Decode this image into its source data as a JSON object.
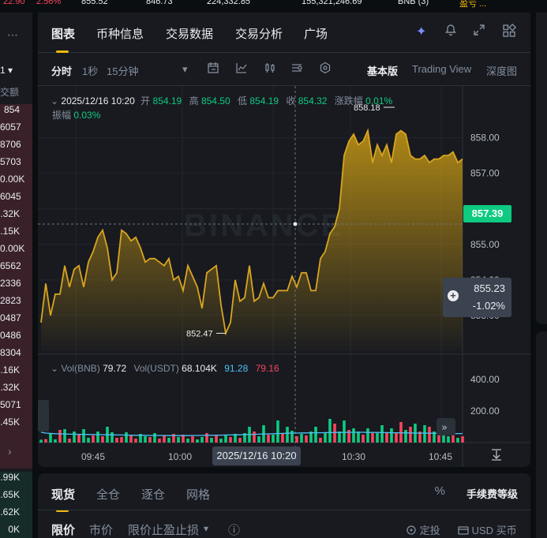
{
  "top_strip": {
    "a": "22.90",
    "b": "2.56%",
    "c": "855.52",
    "d": "846.73",
    "e": "224,332.85",
    "f": "155,321,246.69",
    "g": "BNB (3)",
    "h": "盈亏 ..."
  },
  "orderbook": {
    "selector": "1 ▾",
    "header": "交额",
    "rows": [
      "854",
      "6057",
      "8706",
      "5703",
      "0.00K",
      "6045",
      ".32K",
      ".15K",
      "0.00K",
      "6562",
      "2336",
      "2823",
      "0487",
      "0486",
      "8304",
      ".16K",
      ".32K",
      "5071",
      ".45K",
      "",
      "",
      ".99K",
      ".65K",
      ".62K",
      "0K"
    ]
  },
  "tabs": [
    "图表",
    "币种信息",
    "交易数据",
    "交易分析",
    "广场"
  ],
  "toolbar": {
    "time_active": "分时",
    "time_1s": "1秒",
    "time_15m": "15分钟",
    "dropdown_caret": "▾",
    "view_basic": "基本版",
    "view_tv": "Trading View",
    "view_depth": "深度图"
  },
  "ohlc": {
    "collapse": "⌄",
    "datetime": "2025/12/16 10:20",
    "open_label": "开",
    "open": "854.19",
    "high_label": "高",
    "high": "854.50",
    "low_label": "低",
    "low": "854.19",
    "close_label": "收",
    "close": "854.32",
    "change_label": "涨跌幅",
    "change": "0.01%",
    "amp_label": "振幅",
    "amp": "0.03%"
  },
  "volume_legend": {
    "collapse": "⌄",
    "vol_bnb_label": "Vol(BNB)",
    "vol_bnb": "79.72",
    "vol_usdt_label": "Vol(USDT)",
    "vol_usdt": "68.104K",
    "ma1": "91.28",
    "ma2": "79.16"
  },
  "watermark": "BINANCE",
  "current_price": "857.39",
  "crosshair": {
    "price": "855.23",
    "pct": "-1.02%",
    "time": "2025/12/16 10:20"
  },
  "annotations": {
    "low_label": "852.47",
    "high_label": "858.18"
  },
  "colors": {
    "up": "#0ecb81",
    "down": "#f6465d",
    "accent": "#f0b90b",
    "line": "#d9a520",
    "ma": "#4cc3f5"
  },
  "chart_data": {
    "type": "area",
    "x_ticks": [
      "09:45",
      "10:00",
      "10:30",
      "10:45"
    ],
    "y_ticks": [
      "858.00",
      "857.00",
      "856.00",
      "855.00",
      "854.00",
      "853.00"
    ],
    "ylim": [
      852.0,
      858.9
    ],
    "vol_ticks": [
      "400.00",
      "200.00"
    ],
    "vol_lim": [
      0,
      450
    ],
    "price": [
      852.8,
      853.9,
      853.0,
      853.6,
      853.6,
      854.4,
      853.8,
      854.3,
      854.4,
      853.8,
      854.5,
      854.8,
      855.2,
      855.4,
      854.9,
      854.0,
      854.2,
      855.4,
      855.3,
      855.1,
      855.2,
      854.9,
      854.5,
      854.6,
      854.6,
      854.5,
      854.4,
      854.6,
      854.0,
      854.1,
      853.7,
      854.4,
      854.1,
      853.8,
      853.2,
      854.2,
      854.3,
      854.4,
      853.3,
      852.5,
      852.8,
      854.0,
      853.4,
      853.5,
      854.4,
      853.4,
      853.5,
      853.9,
      853.5,
      853.5,
      853.7,
      853.7,
      853.7,
      854.1,
      853.8,
      854.2,
      854.2,
      853.7,
      853.7,
      854.6,
      854.8,
      855.3,
      855.5,
      856.0,
      857.5,
      857.9,
      858.1,
      857.8,
      857.9,
      858.2,
      857.3,
      857.8,
      857.5,
      857.8,
      857.3,
      858.1,
      858.2,
      858.1,
      857.5,
      857.4,
      857.4,
      857.5,
      857.3,
      857.4,
      857.4,
      857.5,
      857.5,
      857.6,
      857.3,
      857.4
    ],
    "volume": [
      18,
      22,
      60,
      20,
      80,
      85,
      25,
      70,
      55,
      85,
      30,
      45,
      70,
      40,
      100,
      65,
      30,
      35,
      65,
      50,
      25,
      55,
      40,
      35,
      60,
      25,
      45,
      30,
      55,
      35,
      50,
      25,
      40,
      20,
      35,
      60,
      30,
      50,
      25,
      45,
      35,
      55,
      30,
      60,
      100,
      70,
      40,
      110,
      50,
      50,
      140,
      60,
      100,
      75,
      40,
      55,
      45,
      70,
      100,
      30,
      60,
      150,
      120,
      70,
      140,
      80,
      90,
      70,
      50,
      90,
      60,
      60,
      110,
      60,
      90,
      60,
      130,
      80,
      100,
      120,
      70,
      110,
      100,
      70,
      50,
      90,
      40,
      50,
      30,
      40
    ],
    "volume_up": [
      1,
      0,
      1,
      1,
      0,
      1,
      0,
      1,
      0,
      1,
      1,
      0,
      1,
      0,
      1,
      1,
      0,
      0,
      1,
      0,
      0,
      1,
      1,
      0,
      1,
      0,
      0,
      1,
      0,
      1,
      0,
      1,
      0,
      1,
      1,
      0,
      1,
      0,
      1,
      1,
      0,
      1,
      0,
      1,
      1,
      0,
      1,
      1,
      0,
      1,
      1,
      0,
      1,
      1,
      0,
      1,
      0,
      1,
      1,
      0,
      1,
      1,
      0,
      1,
      1,
      0,
      1,
      1,
      0,
      1,
      0,
      1,
      1,
      0,
      1,
      0,
      0,
      1,
      0,
      1,
      0,
      1,
      0,
      1,
      0,
      1,
      1,
      0,
      1,
      0
    ],
    "ma_line": [
      65,
      60,
      58,
      56,
      55,
      54,
      53,
      53,
      52,
      52,
      51,
      51,
      50,
      50,
      49,
      49,
      48,
      48,
      47,
      47,
      46,
      46,
      46,
      45,
      45,
      45,
      45,
      44,
      44,
      44,
      44,
      44,
      45,
      45,
      45,
      46,
      46,
      47,
      47,
      48,
      48,
      49,
      49,
      50,
      51,
      52,
      53,
      54,
      55,
      56,
      57,
      58,
      59,
      60,
      60,
      61,
      61,
      62,
      62,
      62,
      63,
      63,
      64,
      64,
      64,
      65,
      65,
      65,
      65,
      64,
      64,
      64,
      63,
      63,
      62,
      62,
      62,
      61,
      61,
      60,
      60,
      60,
      59,
      59,
      58,
      58,
      58,
      57,
      57,
      57
    ]
  },
  "order_tabs": [
    "现货",
    "全仓",
    "逐仓",
    "网格"
  ],
  "fee_label": "手续费等级",
  "order_sub": {
    "limit": "限价",
    "market": "市价",
    "stop": "限价止盈止损",
    "caret": "▾",
    "info": "ⓘ",
    "tpsl": "定投",
    "usd": "USD 买币"
  }
}
